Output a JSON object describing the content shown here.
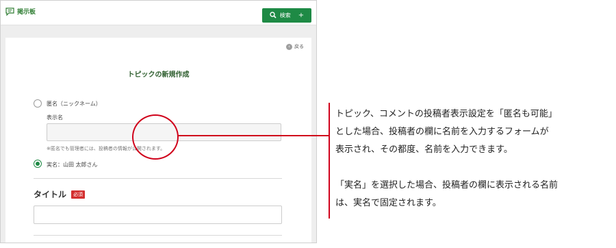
{
  "header": {
    "app_title": "掲示板",
    "search_label": "検索",
    "add_label": "+"
  },
  "panel": {
    "back_label": "戻る",
    "form_title": "トピックの新規作成",
    "anonymous_option": "匿名（ニックネーム）",
    "display_name_label": "表示名",
    "display_name_value": "",
    "anonymous_note": "※匿名でも管理者には、投稿者の情報が公開されます。",
    "real_name_option": "実名：山田 太郎さん",
    "title_label": "タイトル",
    "required_badge": "必須",
    "title_value": ""
  },
  "explanation": {
    "line1": "トピック、コメントの投稿者表示設定を「匿名も可能」",
    "line2": "とした場合、投稿者の欄に名前を入力するフォームが",
    "line3": "表示され、その都度、名前を入力できます。",
    "line4": "「実名」を選択した場合、投稿者の欄に表示される名前",
    "line5": "は、実名で固定されます。"
  },
  "colors": {
    "accent_green": "#1e8a45",
    "callout_red": "#d0021b",
    "required_red": "#d32f2f"
  },
  "icons": [
    "bulletin-board-icon",
    "search-icon",
    "back-icon"
  ]
}
